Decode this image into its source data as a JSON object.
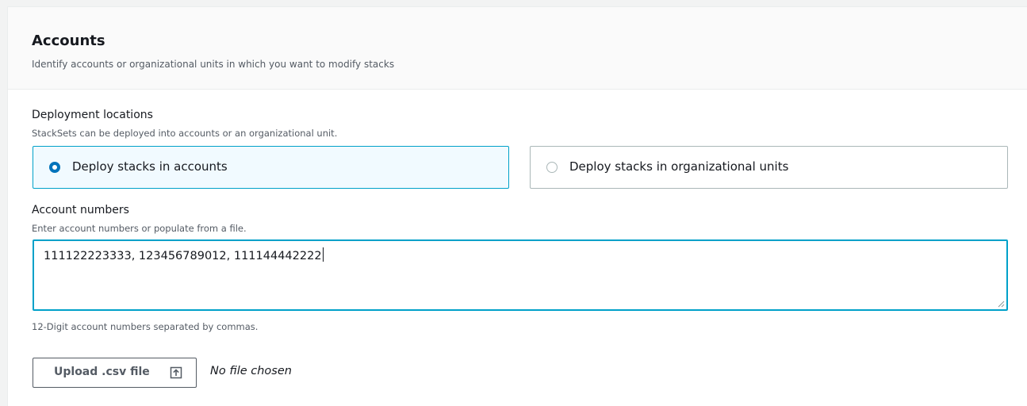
{
  "section": {
    "title": "Accounts",
    "description": "Identify accounts or organizational units in which you want to modify stacks"
  },
  "deployment": {
    "label": "Deployment locations",
    "description": "StackSets can be deployed into accounts or an organizational unit.",
    "options": [
      {
        "label": "Deploy stacks in accounts",
        "selected": true
      },
      {
        "label": "Deploy stacks in organizational units",
        "selected": false
      }
    ]
  },
  "account_numbers": {
    "label": "Account numbers",
    "description": "Enter account numbers or populate from a file.",
    "value": "111122223333, 123456789012, 111144442222",
    "constraint": "12-Digit account numbers separated by commas."
  },
  "upload": {
    "button_label": "Upload .csv file",
    "icon": "upload-icon",
    "status": "No file chosen"
  },
  "colors": {
    "accent": "#0073bb",
    "focus_border": "#00a1c9",
    "selected_tile_bg": "#f1faff"
  }
}
